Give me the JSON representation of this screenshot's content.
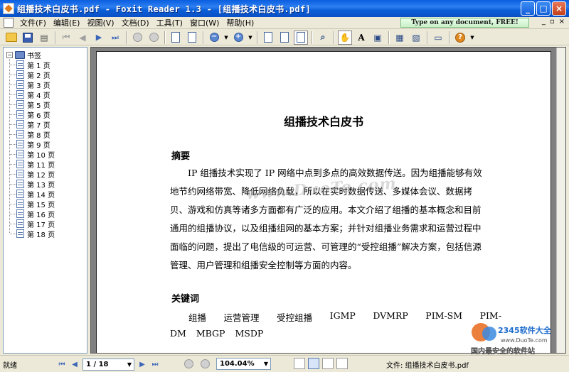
{
  "window": {
    "title": "组播技术白皮书.pdf - Foxit Reader 1.3 - [组播技术白皮书.pdf]",
    "minimize_label": "_",
    "maximize_label": "□",
    "close_label": "×"
  },
  "menubar": {
    "items": [
      {
        "label": "文件(F)"
      },
      {
        "label": "编辑(E)"
      },
      {
        "label": "视图(V)"
      },
      {
        "label": "文档(D)"
      },
      {
        "label": "工具(T)"
      },
      {
        "label": "窗口(W)"
      },
      {
        "label": "帮助(H)"
      }
    ],
    "ad_text": "Type on any document, FREE!",
    "mdi_minimize": "_",
    "mdi_restore": "▫",
    "mdi_close": "×"
  },
  "bookmarks": {
    "root_label": "书签",
    "root_toggle": "−",
    "items": [
      {
        "label": "第 1 页"
      },
      {
        "label": "第 2 页"
      },
      {
        "label": "第 3 页"
      },
      {
        "label": "第 4 页"
      },
      {
        "label": "第 5 页"
      },
      {
        "label": "第 6 页"
      },
      {
        "label": "第 7 页"
      },
      {
        "label": "第 8 页"
      },
      {
        "label": "第 9 页"
      },
      {
        "label": "第 10 页"
      },
      {
        "label": "第 11 页"
      },
      {
        "label": "第 12 页"
      },
      {
        "label": "第 13 页"
      },
      {
        "label": "第 14 页"
      },
      {
        "label": "第 15 页"
      },
      {
        "label": "第 16 页"
      },
      {
        "label": "第 17 页"
      },
      {
        "label": "第 18 页"
      }
    ]
  },
  "document": {
    "title": "组播技术白皮书",
    "abstract_heading": "摘要",
    "abstract_lines": [
      "　　IP 组播技术实现了 IP 网络中点到多点的高效数据传送。因为组播能够有效",
      "地节约网络带宽、降低网络负载，所以在实时数据传送、多媒体会议、数据拷",
      "贝、游戏和仿真等诸多方面都有广泛的应用。本文介绍了组播的基本概念和目前",
      "通用的组播协议，以及组播组网的基本方案；并针对组播业务需求和运营过程中",
      "面临的问题，提出了电信级的可运营、可管理的“受控组播”解决方案，包括信源",
      "管理、用户管理和组播安全控制等方面的内容。"
    ],
    "keywords_heading": "关键词",
    "keywords_row1": [
      "组播",
      "运营管理",
      "受控组播",
      "IGMP",
      "DVMRP",
      "PIM-SM",
      "PIM-"
    ],
    "keywords_row2": [
      "DM",
      "MBGP",
      "MSDP"
    ],
    "watermark": "www.DuoTe.com"
  },
  "statusbar": {
    "status": "就绪",
    "page_indicator": "1 / 18",
    "zoom": "104.04%",
    "file_label": "文件:  组播技术白皮书.pdf"
  },
  "logo": {
    "brand": "2345软件大全",
    "url": "www.DuoTe.com",
    "slogan": "国内最安全的软件站"
  },
  "colors": {
    "titlebar": "#0a5ee0",
    "chrome": "#ece9d8",
    "doc_background": "#808080",
    "accent_blue": "#3a64b8"
  }
}
